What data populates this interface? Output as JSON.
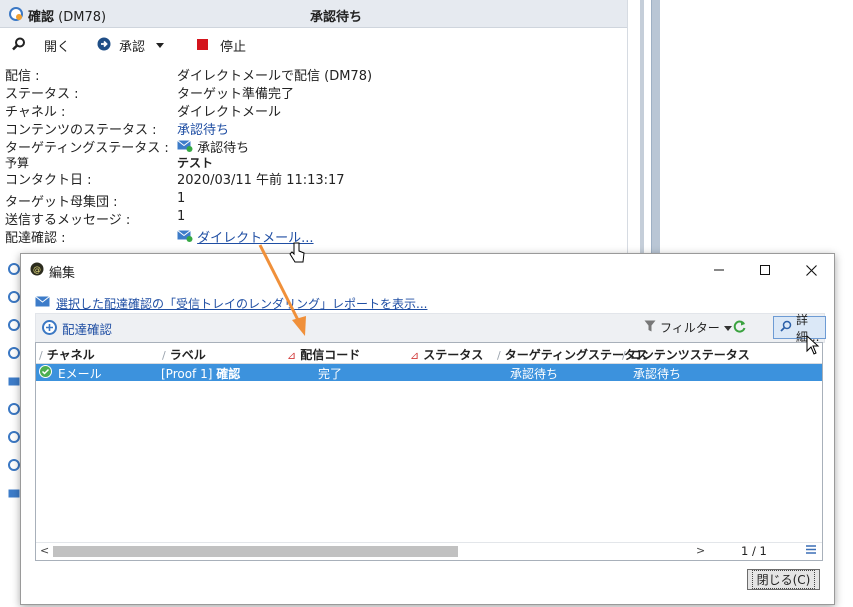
{
  "background": {
    "title_prefix": "確認",
    "title_code": "(DM78)",
    "state": "承認待ち",
    "toolbar": {
      "open": "開く",
      "approve": "承認",
      "stop": "停止"
    },
    "properties": [
      {
        "key": "配信 :",
        "value": "ダイレクトメールで配信 (DM78)"
      },
      {
        "key": "ステータス :",
        "value": "ターゲット準備完了"
      },
      {
        "key": "チャネル :",
        "value": "ダイレクトメール"
      },
      {
        "key": "コンテンツのステータス :",
        "value": "承認待ち"
      },
      {
        "key": "ターゲティングステータス :",
        "value": "承認待ち"
      },
      {
        "key": "予算",
        "value": "テスト"
      },
      {
        "key": "コンタクト日 :",
        "value": "2020/03/11 午前 11:13:17"
      },
      {
        "key": "ターゲット母集団 :",
        "value": "1"
      },
      {
        "key": "送信するメッセージ :",
        "value": "1"
      },
      {
        "key": "配達確認 :",
        "value": "ダイレクトメール..."
      }
    ]
  },
  "dialog": {
    "title": "編集",
    "report_link": "選択した配達確認の「受信トレイのレンダリング」レポートを表示...",
    "toolbar": {
      "label": "配達確認",
      "filter": "フィルター",
      "detail": "詳細..."
    },
    "columns": [
      "チャネル",
      "ラベル",
      "配信コード",
      "ステータス",
      "ターゲティングステータス",
      "コンテンツステータス"
    ],
    "row": {
      "channel": "Eメール",
      "label_proof": "[Proof 1]",
      "label_text": "確認",
      "status": "完了",
      "targeting": "承認待ち",
      "content": "承認待ち"
    },
    "pagination": "1 / 1",
    "close": "閉じる(C)"
  },
  "colors": {
    "accent": "#3c92dd",
    "link": "#1f4ea3",
    "arrow": "#f0903a",
    "stop": "#d4141c"
  }
}
